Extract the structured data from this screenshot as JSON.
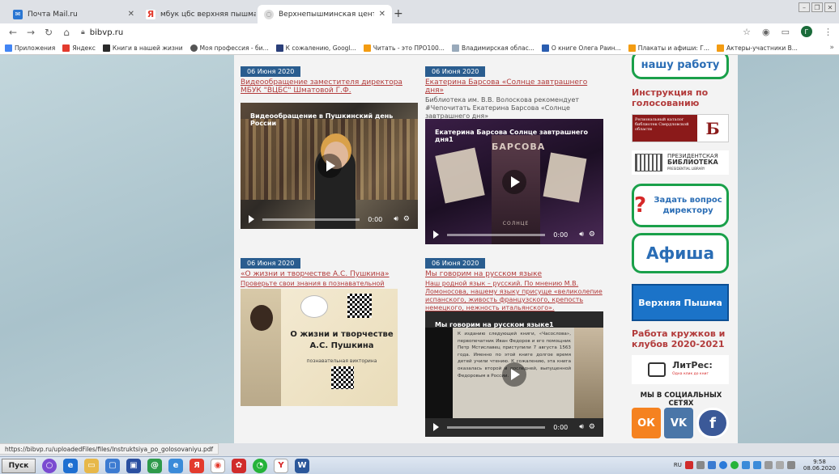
{
  "browser": {
    "tabs": [
      {
        "title": "Почта Mail.ru",
        "icon": "mail-icon",
        "color": "#2a76d2"
      },
      {
        "title": "мбук цбс верхняя пышма — Яндекс",
        "icon": "yandex-icon",
        "color": "#e33b2e"
      },
      {
        "title": "Верхнепышминская централизован",
        "icon": "site-icon",
        "color": "#888888"
      }
    ],
    "new_tab": "+",
    "url": "bibvp.ru",
    "bookmarks": [
      {
        "label": "Приложения",
        "color": "#4285f4"
      },
      {
        "label": "Яндекс",
        "color": "#e33b2e"
      },
      {
        "label": "Книги в нашей жизни",
        "color": "#2a2a2a"
      },
      {
        "label": "Моя профессия - би...",
        "color": "#555555"
      },
      {
        "label": "К сожалению, Googl...",
        "color": "#2a3f7a"
      },
      {
        "label": "Читать - это ПРО100...",
        "color": "#f39c12"
      },
      {
        "label": "Владимирская облас...",
        "color": "#9ab"
      },
      {
        "label": "О книге Олега Раин...",
        "color": "#2a5db0"
      },
      {
        "label": "Плакаты и афиши: Г...",
        "color": "#f39c12"
      },
      {
        "label": "Актеры-участники В...",
        "color": "#f39c12"
      }
    ],
    "avatar_letter": "Г",
    "status_url": "https://bibvp.ru/uploadedFiles/files/Instruktsiya_po_golosovaniyu.pdf"
  },
  "news": [
    {
      "date": "06 Июня 2020",
      "title": "Видеообращение заместителя директора МБУК \"ВЦБС\" Шматовой Г.Ф.",
      "desc": "",
      "video_title": "Видеообращение в Пушкинский день России",
      "time": "0:00"
    },
    {
      "date": "06 Июня 2020",
      "title": "Екатерина Барсова «Солнце завтрашнего дня»",
      "desc": "Библиотека им. В.В. Волоскова рекомендует #Чепочитать Екатерина Барсова «Солнце завтрашнего дня»",
      "video_title": "Екатерина Барсова Солнце завтрашнего дня1",
      "poster_text": "БАРСОВА",
      "poster_sub": "СОЛНЦЕ",
      "time": "0:00"
    },
    {
      "date": "06 Июня 2020",
      "title": "«О жизни и творчестве А.С. Пушкина»",
      "desc": "Проверьте свои знания в познавательной викторине",
      "slide_title": "О жизни и творчестве А.С. Пушкина",
      "slide_sub": "познавательная викторина"
    },
    {
      "date": "06 Июня 2020",
      "title": "Мы говорим на русском языке",
      "desc": "Наш родной язык – русский. По мнению М.В. Ломоносова, нашему языку присуще «великолепие испанского, живость французского, крепость немецкого, нежность итальянского».",
      "video_title": "Мы говорим на русском языке1",
      "video_text": "К изданию следующей книги, «Часослова», первопечатник Иван Федоров и его помощник Петр Мстиславец приступили 7 августа 1563 года. Именно по этой книге долгое время детей учили чтению. К сожалению, эта книга оказалась второй и последней, выпущенной Федоровым в России.",
      "time": "0:00"
    }
  ],
  "sidebar": {
    "top_button": "нашу работу",
    "instruction_heading": "Инструкция по голосованию",
    "catalog_banner": "Региональный каталог библиотек Свердловской области",
    "catalog_letter": "Б",
    "presidential_banner_1": "ПРЕЗИДЕНТСКАЯ",
    "presidential_banner_2": "БИБЛИОТЕКА",
    "presidential_banner_3": "PRESIDENTIAL LIBRARY",
    "ask_button": "Задать вопрос директору",
    "ask_mark": "?",
    "afisha": "Афиша",
    "city": "Верхняя Пышма",
    "clubs_heading": "Работа кружков и клубов 2020-2021",
    "litres": "ЛитРес:",
    "litres_sub": "Одна клик до книг",
    "social_heading": "МЫ В СОЦИАЛЬНЫХ СЕТЯХ",
    "social": [
      {
        "name": "ok-icon",
        "glyph": "ОК",
        "color": "#f58220"
      },
      {
        "name": "vk-icon",
        "glyph": "VK",
        "color": "#4a76a8"
      },
      {
        "name": "facebook-icon",
        "glyph": "f",
        "color": "#3b5998"
      }
    ]
  },
  "taskbar": {
    "start": "Пуск",
    "lang": "RU",
    "time": "9:58",
    "date": "08.06.2020"
  }
}
